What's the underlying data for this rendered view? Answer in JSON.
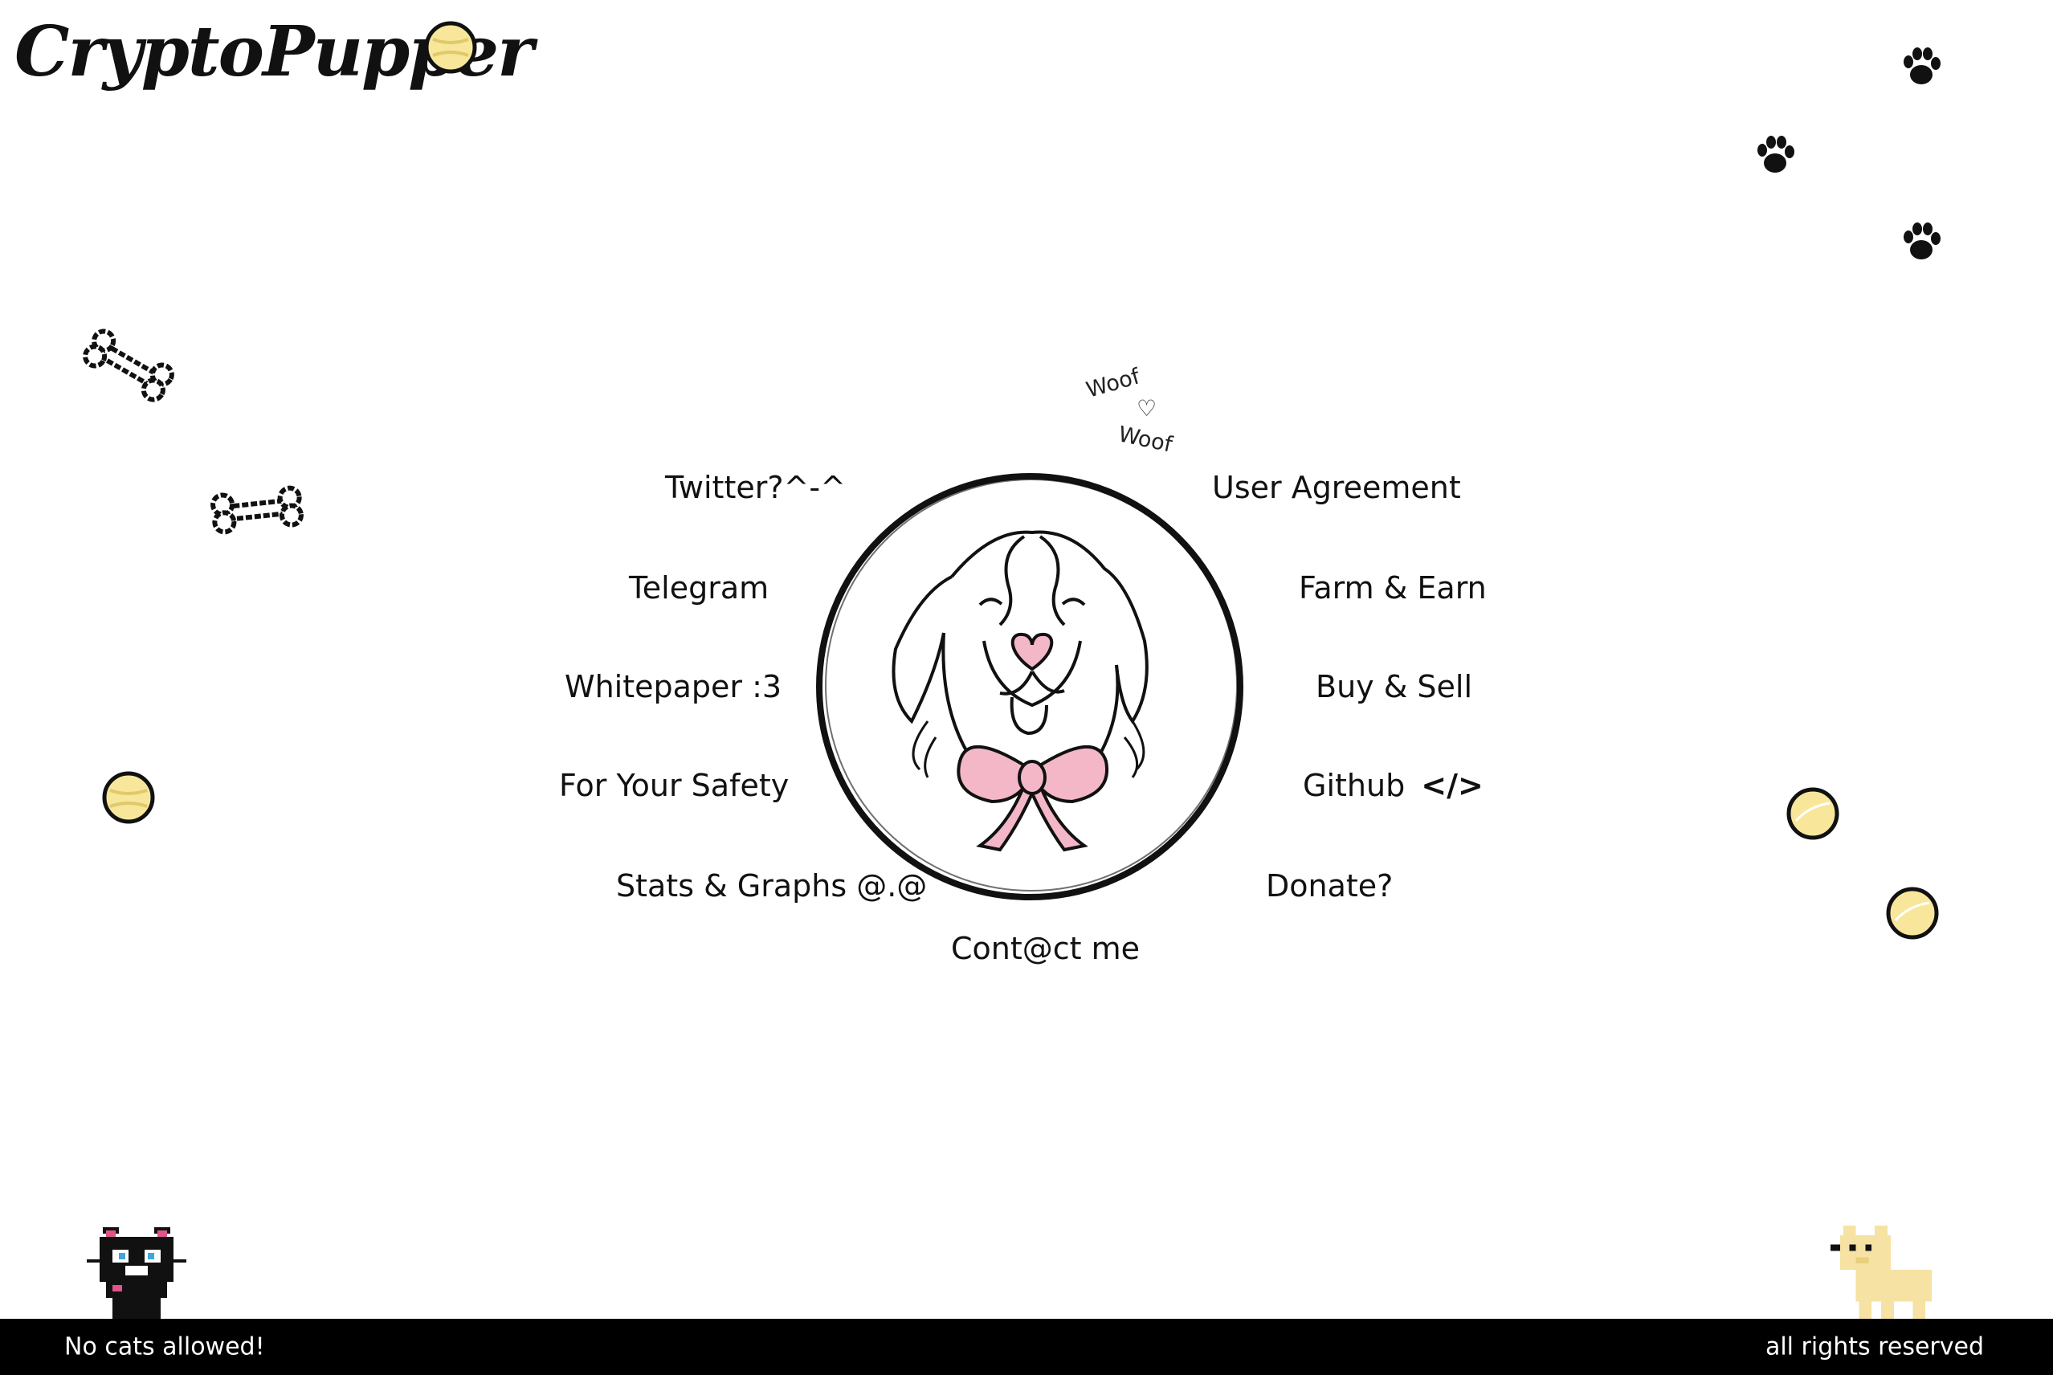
{
  "brand": {
    "name": "CryptoPupper"
  },
  "decor": {
    "woof_top": "Woof",
    "woof_bottom": "Woof",
    "heart_glyph": "♡",
    "ball_color": "#f8e79a",
    "accent_pink": "#f3b7c8"
  },
  "nav": {
    "left": [
      {
        "label": "Twitter?^-^"
      },
      {
        "label": "Telegram"
      },
      {
        "label": "Whitepaper :3"
      },
      {
        "label": "For Your Safety"
      },
      {
        "label": "Stats & Graphs @.@"
      }
    ],
    "right": [
      {
        "label": "User Agreement"
      },
      {
        "label": "Farm & Earn"
      },
      {
        "label": "Buy & Sell"
      },
      {
        "label": "Github"
      },
      {
        "label": "Donate?"
      }
    ],
    "github_icon": "</>",
    "bottom": {
      "label": "Cont@ct me"
    }
  },
  "footer": {
    "left": "No cats allowed!",
    "right": "all rights reserved"
  }
}
